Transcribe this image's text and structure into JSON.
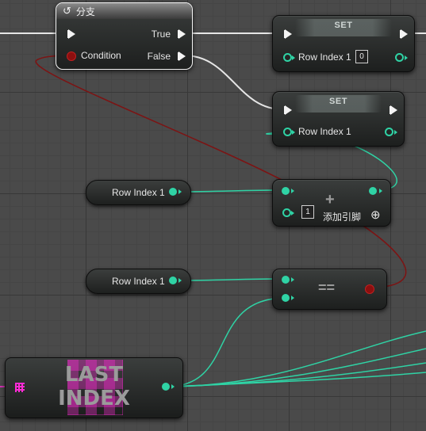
{
  "branch": {
    "title": "分支",
    "true_label": "True",
    "false_label": "False",
    "condition_label": "Condition"
  },
  "set_node_1": {
    "title": "SET",
    "var_label": "Row Index 1",
    "literal_value": "0"
  },
  "set_node_2": {
    "title": "SET",
    "var_label": "Row Index 1"
  },
  "add_node": {
    "op_symbol": "+",
    "literal_value": "1",
    "add_pin_label": "添加引脚",
    "add_pin_icon": "⊕"
  },
  "getter_1": {
    "label": "Row Index 1"
  },
  "getter_2": {
    "label": "Row Index 1"
  },
  "equal_node": {
    "op_symbol": "=="
  },
  "last_index": {
    "line1": "LAST",
    "line2": "INDEX"
  },
  "colors": {
    "exec": "#f4f4f4",
    "integer": "#2fd3a5",
    "boolean": "#8c0f0f",
    "array": "#ff2bd6",
    "bool_wire": "#7c1414"
  }
}
